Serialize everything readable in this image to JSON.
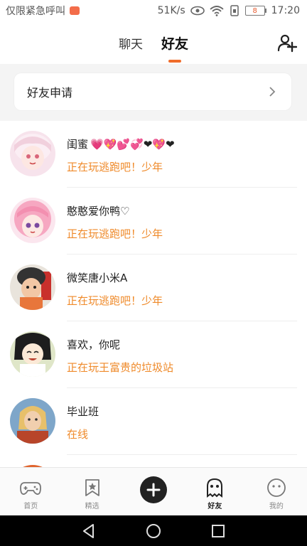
{
  "status_bar": {
    "left_text": "仅限紧急呼叫",
    "speed": "51K/s",
    "battery": "8",
    "time": "17:20"
  },
  "header": {
    "tabs": [
      {
        "label": "聊天",
        "active": false
      },
      {
        "label": "好友",
        "active": true
      }
    ],
    "add_friend_icon": "add-user-icon"
  },
  "friend_request": {
    "label": "好友申请"
  },
  "friends": [
    {
      "name": "闺蜜",
      "hearts": "💗💖💕💞❤💖❤",
      "status": "正在玩逃跑吧！少年",
      "avatar_color": "#f5d3e0"
    },
    {
      "name": "憨憨爱你鸭♡",
      "status": "正在玩逃跑吧！少年",
      "avatar_color": "#f6a7c1"
    },
    {
      "name": "微笑唐小米A",
      "status": "正在玩逃跑吧！少年",
      "avatar_color": "#d88a58"
    },
    {
      "name": "喜欢，你呢",
      "status": "正在玩王富贵的垃圾站",
      "avatar_color": "#6f7d49"
    },
    {
      "name": "毕业班",
      "status": "在线",
      "avatar_color": "#c46a2e"
    }
  ],
  "tabbar": {
    "items": [
      {
        "label": "首页",
        "icon": "gamepad-icon"
      },
      {
        "label": "精选",
        "icon": "star-bookmark-icon"
      },
      {
        "label": "",
        "icon": "plus-icon"
      },
      {
        "label": "好友",
        "icon": "ghost-icon",
        "active": true
      },
      {
        "label": "我的",
        "icon": "face-icon"
      }
    ]
  },
  "colors": {
    "accent": "#f06c2a",
    "status_orange": "#ef8a2a"
  }
}
